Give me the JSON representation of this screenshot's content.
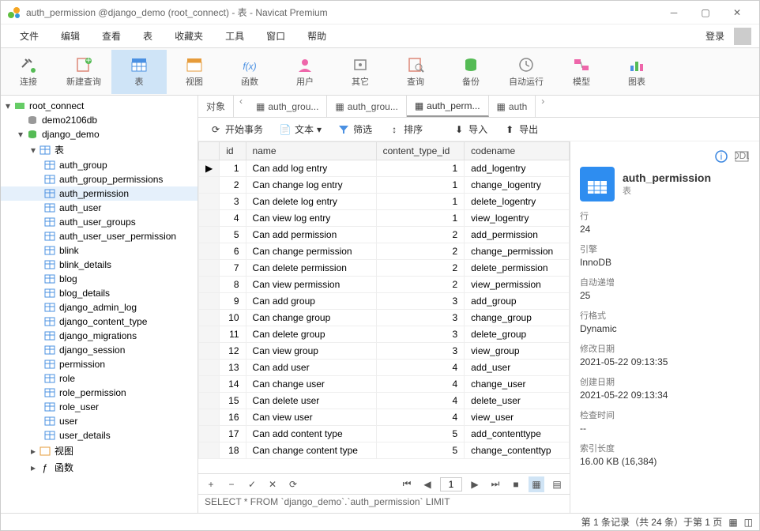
{
  "window": {
    "title": "auth_permission @django_demo (root_connect) - 表 - Navicat Premium"
  },
  "menu": {
    "items": [
      "文件",
      "编辑",
      "查看",
      "表",
      "收藏夹",
      "工具",
      "窗口",
      "帮助"
    ],
    "login": "登录"
  },
  "toolbar": {
    "items": [
      {
        "label": "连接",
        "icon": "plug"
      },
      {
        "label": "新建查询",
        "icon": "newquery"
      },
      {
        "label": "表",
        "icon": "table",
        "active": true
      },
      {
        "label": "视图",
        "icon": "view"
      },
      {
        "label": "函数",
        "icon": "fx"
      },
      {
        "label": "用户",
        "icon": "user"
      },
      {
        "label": "其它",
        "icon": "other"
      },
      {
        "label": "查询",
        "icon": "query"
      },
      {
        "label": "备份",
        "icon": "backup"
      },
      {
        "label": "自动运行",
        "icon": "auto"
      },
      {
        "label": "模型",
        "icon": "model"
      },
      {
        "label": "图表",
        "icon": "chart"
      }
    ]
  },
  "tree": {
    "root": "root_connect",
    "db_demo": "demo2106db",
    "db_django": "django_demo",
    "group_table": "表",
    "group_view": "视图",
    "group_func": "函数",
    "tables": [
      "auth_group",
      "auth_group_permissions",
      "auth_permission",
      "auth_user",
      "auth_user_groups",
      "auth_user_user_permission",
      "blink",
      "blink_details",
      "blog",
      "blog_details",
      "django_admin_log",
      "django_content_type",
      "django_migrations",
      "django_session",
      "permission",
      "role",
      "role_permission",
      "role_user",
      "user",
      "user_details"
    ]
  },
  "tabs": {
    "obj": "对象",
    "t1": "auth_grou...",
    "t2": "auth_grou...",
    "t3": "auth_perm...",
    "t4": "auth"
  },
  "subtoolbar": {
    "begin": "开始事务",
    "text": "文本",
    "filter": "筛选",
    "sort": "排序",
    "import": "导入",
    "export": "导出"
  },
  "grid": {
    "cols": [
      "id",
      "name",
      "content_type_id",
      "codename"
    ],
    "rows": [
      {
        "id": 1,
        "name": "Can add log entry",
        "ct": 1,
        "code": "add_logentry"
      },
      {
        "id": 2,
        "name": "Can change log entry",
        "ct": 1,
        "code": "change_logentry"
      },
      {
        "id": 3,
        "name": "Can delete log entry",
        "ct": 1,
        "code": "delete_logentry"
      },
      {
        "id": 4,
        "name": "Can view log entry",
        "ct": 1,
        "code": "view_logentry"
      },
      {
        "id": 5,
        "name": "Can add permission",
        "ct": 2,
        "code": "add_permission"
      },
      {
        "id": 6,
        "name": "Can change permission",
        "ct": 2,
        "code": "change_permission"
      },
      {
        "id": 7,
        "name": "Can delete permission",
        "ct": 2,
        "code": "delete_permission"
      },
      {
        "id": 8,
        "name": "Can view permission",
        "ct": 2,
        "code": "view_permission"
      },
      {
        "id": 9,
        "name": "Can add group",
        "ct": 3,
        "code": "add_group"
      },
      {
        "id": 10,
        "name": "Can change group",
        "ct": 3,
        "code": "change_group"
      },
      {
        "id": 11,
        "name": "Can delete group",
        "ct": 3,
        "code": "delete_group"
      },
      {
        "id": 12,
        "name": "Can view group",
        "ct": 3,
        "code": "view_group"
      },
      {
        "id": 13,
        "name": "Can add user",
        "ct": 4,
        "code": "add_user"
      },
      {
        "id": 14,
        "name": "Can change user",
        "ct": 4,
        "code": "change_user"
      },
      {
        "id": 15,
        "name": "Can delete user",
        "ct": 4,
        "code": "delete_user"
      },
      {
        "id": 16,
        "name": "Can view user",
        "ct": 4,
        "code": "view_user"
      },
      {
        "id": 17,
        "name": "Can add content type",
        "ct": 5,
        "code": "add_contenttype"
      },
      {
        "id": 18,
        "name": "Can change content type",
        "ct": 5,
        "code": "change_contenttyp"
      }
    ],
    "page": "1"
  },
  "sql": "SELECT * FROM `django_demo`.`auth_permission` LIMIT",
  "info": {
    "name": "auth_permission",
    "type": "表",
    "rows_label": "行",
    "rows_val": "24",
    "engine_label": "引擎",
    "engine_val": "InnoDB",
    "ai_label": "自动递增",
    "ai_val": "25",
    "fmt_label": "行格式",
    "fmt_val": "Dynamic",
    "mod_label": "修改日期",
    "mod_val": "2021-05-22 09:13:35",
    "crt_label": "创建日期",
    "crt_val": "2021-05-22 09:13:34",
    "chk_label": "检查时间",
    "chk_val": "--",
    "idx_label": "索引长度",
    "idx_val": "16.00 KB (16,384)"
  },
  "status": "第 1 条记录（共 24 条）于第 1 页"
}
